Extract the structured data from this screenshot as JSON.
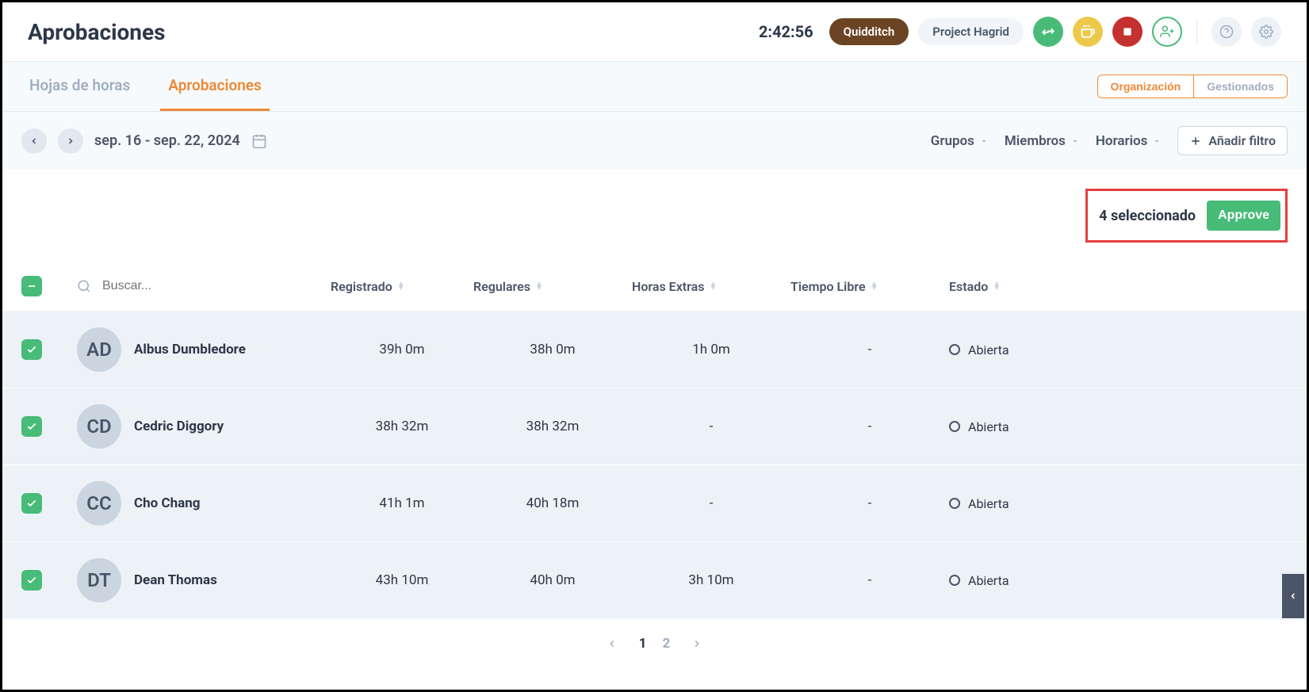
{
  "header": {
    "title": "Aprobaciones",
    "timer": "2:42:56",
    "pill1": "Quidditch",
    "pill2": "Project Hagrid"
  },
  "tabs": {
    "tab1": "Hojas de horas",
    "tab2": "Aprobaciones",
    "view1": "Organización",
    "view2": "Gestionados"
  },
  "filters": {
    "date_range": "sep. 16 - sep. 22, 2024",
    "groups": "Grupos",
    "members": "Miembros",
    "schedules": "Horarios",
    "add_filter": "Añadir filtro"
  },
  "selection": {
    "count_text": "4 seleccionado",
    "approve": "Approve"
  },
  "table": {
    "search_placeholder": "Buscar...",
    "col_registrado": "Registrado",
    "col_regulares": "Regulares",
    "col_extras": "Horas Extras",
    "col_libre": "Tiempo Libre",
    "col_estado": "Estado",
    "rows": [
      {
        "name": "Albus Dumbledore",
        "registrado": "39h 0m",
        "regulares": "38h 0m",
        "extras": "1h 0m",
        "libre": "-",
        "estado": "Abierta",
        "initials": "AD"
      },
      {
        "name": "Cedric Diggory",
        "registrado": "38h 32m",
        "regulares": "38h 32m",
        "extras": "-",
        "libre": "-",
        "estado": "Abierta",
        "initials": "CD"
      },
      {
        "name": "Cho Chang",
        "registrado": "41h 1m",
        "regulares": "40h 18m",
        "extras": "-",
        "libre": "-",
        "estado": "Abierta",
        "initials": "CC"
      },
      {
        "name": "Dean Thomas",
        "registrado": "43h 10m",
        "regulares": "40h 0m",
        "extras": "3h 10m",
        "libre": "-",
        "estado": "Abierta",
        "initials": "DT"
      }
    ]
  },
  "pagination": {
    "page1": "1",
    "page2": "2"
  }
}
